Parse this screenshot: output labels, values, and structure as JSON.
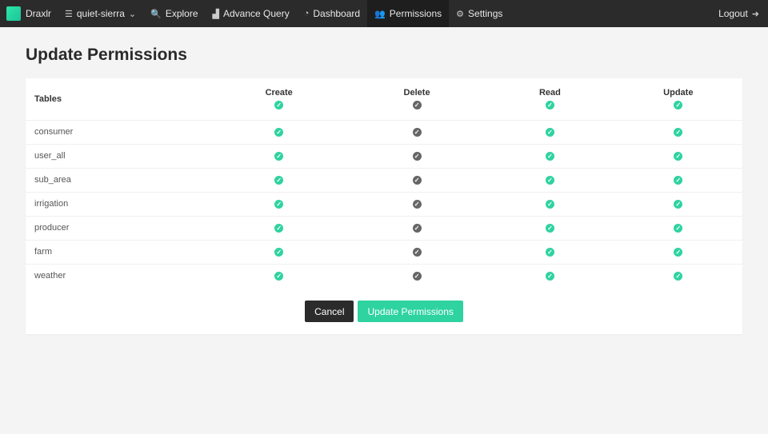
{
  "nav": {
    "brand": "Draxlr",
    "db": "quiet-sierra",
    "items": [
      {
        "label": "Explore",
        "icon": "search-icon",
        "glyph": "🔍"
      },
      {
        "label": "Advance Query",
        "icon": "chart-icon",
        "glyph": "▟"
      },
      {
        "label": "Dashboard",
        "icon": "dashboard-icon",
        "glyph": "◔"
      },
      {
        "label": "Permissions",
        "icon": "users-icon",
        "glyph": "👥"
      },
      {
        "label": "Settings",
        "icon": "gear-icon",
        "glyph": "⚙"
      }
    ],
    "logout": "Logout"
  },
  "page": {
    "title": "Update Permissions"
  },
  "table": {
    "headers": [
      "Tables",
      "Create",
      "Delete",
      "Read",
      "Update"
    ],
    "header_checks": [
      true,
      false,
      true,
      true
    ],
    "rows": [
      {
        "name": "consumer",
        "perms": [
          true,
          false,
          true,
          true
        ]
      },
      {
        "name": "user_all",
        "perms": [
          true,
          false,
          true,
          true
        ]
      },
      {
        "name": "sub_area",
        "perms": [
          true,
          false,
          true,
          true
        ]
      },
      {
        "name": "irrigation",
        "perms": [
          true,
          false,
          true,
          true
        ]
      },
      {
        "name": "producer",
        "perms": [
          true,
          false,
          true,
          true
        ]
      },
      {
        "name": "farm",
        "perms": [
          true,
          false,
          true,
          true
        ]
      },
      {
        "name": "weather",
        "perms": [
          true,
          false,
          true,
          true
        ]
      }
    ]
  },
  "buttons": {
    "cancel": "Cancel",
    "update": "Update Permissions"
  },
  "colors": {
    "checked": "#2ed3a0",
    "unchecked": "#666666"
  }
}
